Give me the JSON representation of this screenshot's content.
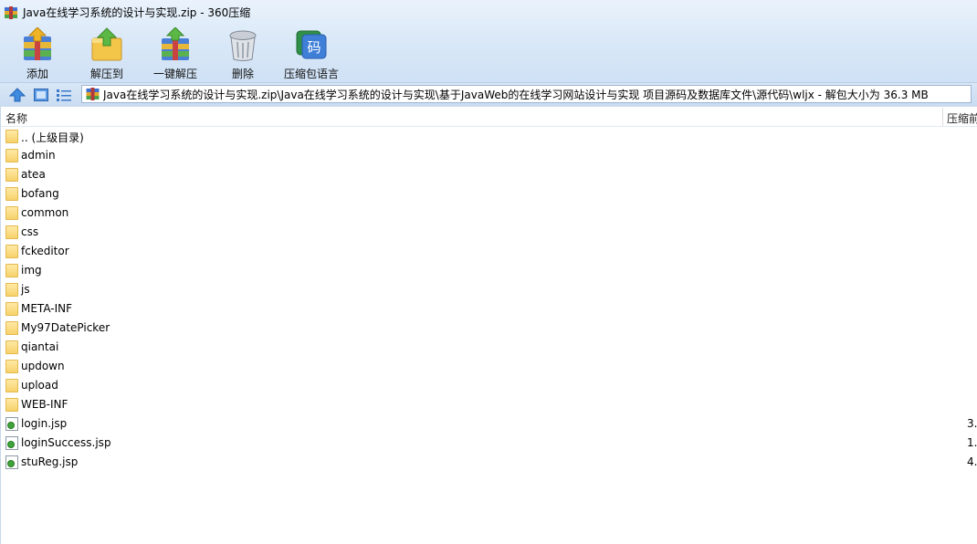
{
  "window": {
    "title": "Java在线学习系统的设计与实现.zip - 360压缩"
  },
  "toolbar": {
    "add_label": "添加",
    "extract_to_label": "解压到",
    "one_click_extract_label": "一键解压",
    "delete_label": "删除",
    "language_label": "压缩包语言",
    "language_badge": "码"
  },
  "address": {
    "path": "Java在线学习系统的设计与实现.zip\\Java在线学习系统的设计与实现\\基于JavaWeb的在线学习网站设计与实现 项目源码及数据库文件\\源代码\\wljx - 解包大小为 36.3 MB"
  },
  "columns": {
    "name": "名称",
    "packed": "压缩前"
  },
  "files": [
    {
      "name": ".. (上级目录)",
      "type": "folder",
      "size": ""
    },
    {
      "name": "admin",
      "type": "folder",
      "size": ""
    },
    {
      "name": "atea",
      "type": "folder",
      "size": ""
    },
    {
      "name": "bofang",
      "type": "folder",
      "size": ""
    },
    {
      "name": "common",
      "type": "folder",
      "size": ""
    },
    {
      "name": "css",
      "type": "folder",
      "size": ""
    },
    {
      "name": "fckeditor",
      "type": "folder",
      "size": ""
    },
    {
      "name": "img",
      "type": "folder",
      "size": ""
    },
    {
      "name": "js",
      "type": "folder",
      "size": ""
    },
    {
      "name": "META-INF",
      "type": "folder",
      "size": ""
    },
    {
      "name": "My97DatePicker",
      "type": "folder",
      "size": ""
    },
    {
      "name": "qiantai",
      "type": "folder",
      "size": ""
    },
    {
      "name": "updown",
      "type": "folder",
      "size": ""
    },
    {
      "name": "upload",
      "type": "folder",
      "size": ""
    },
    {
      "name": "WEB-INF",
      "type": "folder",
      "size": ""
    },
    {
      "name": "login.jsp",
      "type": "jsp",
      "size": "3."
    },
    {
      "name": "loginSuccess.jsp",
      "type": "jsp",
      "size": "1."
    },
    {
      "name": "stuReg.jsp",
      "type": "jsp",
      "size": "4."
    }
  ]
}
